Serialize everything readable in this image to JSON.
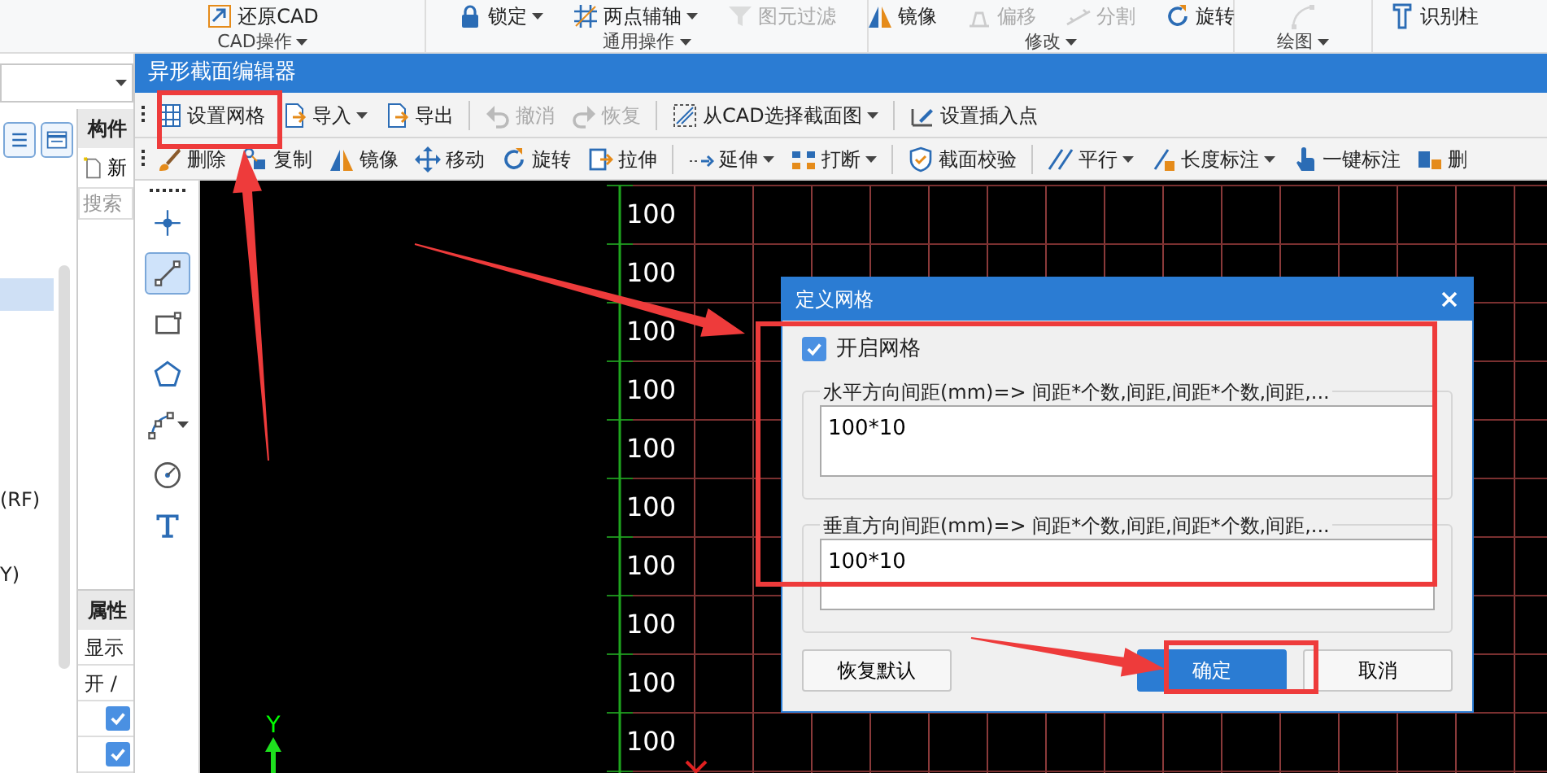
{
  "ribbon": {
    "groups": [
      {
        "label": "CAD操作",
        "items": [
          {
            "label": "还原CAD",
            "disabled": false,
            "dropdown": false
          }
        ]
      },
      {
        "label": "通用操作",
        "items": [
          {
            "label": "锁定",
            "disabled": false,
            "dropdown": true
          },
          {
            "label": "两点辅轴",
            "disabled": false,
            "dropdown": true
          },
          {
            "label": "图元过滤",
            "disabled": true,
            "dropdown": false
          }
        ]
      },
      {
        "label": "修改",
        "items": [
          {
            "label": "镜像",
            "disabled": false,
            "dropdown": false
          },
          {
            "label": "偏移",
            "disabled": true,
            "dropdown": false
          },
          {
            "label": "分割",
            "disabled": true,
            "dropdown": false
          },
          {
            "label": "旋转",
            "disabled": false,
            "dropdown": false
          }
        ]
      },
      {
        "label": "绘图",
        "items": [
          {
            "disabled": true,
            "dropdown": false
          }
        ]
      },
      {
        "items": [
          {
            "label": "识别柱",
            "disabled": false,
            "dropdown": false
          }
        ]
      }
    ]
  },
  "tree_panel": {
    "rows": [
      {
        "selected": true
      },
      {
        "text": "(RF)",
        "selected": false
      },
      {
        "text": "Y)",
        "selected": false
      }
    ]
  },
  "component_panel": {
    "title": "构件",
    "new_label": "新",
    "search_placeholder": "搜索"
  },
  "property_panel": {
    "title": "属性",
    "column_label": "显示",
    "header_cell": "开 /",
    "rows": [
      {
        "checked": true
      },
      {
        "checked": true
      }
    ]
  },
  "editor": {
    "title": "异形截面编辑器",
    "toolbar_1": [
      {
        "kind": "button",
        "label": "设置网格",
        "disabled": false,
        "dropdown": false
      },
      {
        "kind": "button",
        "label": "导入",
        "disabled": false,
        "dropdown": true
      },
      {
        "kind": "button",
        "label": "导出",
        "disabled": false,
        "dropdown": false
      },
      {
        "kind": "separator"
      },
      {
        "kind": "button",
        "label": "撤消",
        "disabled": true,
        "dropdown": false
      },
      {
        "kind": "button",
        "label": "恢复",
        "disabled": true,
        "dropdown": false
      },
      {
        "kind": "separator"
      },
      {
        "kind": "button",
        "label": "从CAD选择截面图",
        "disabled": false,
        "dropdown": true
      },
      {
        "kind": "separator"
      },
      {
        "kind": "button",
        "label": "设置插入点",
        "disabled": false,
        "dropdown": false
      }
    ],
    "toolbar_2": [
      {
        "kind": "button",
        "label": "删除",
        "disabled": false,
        "dropdown": false
      },
      {
        "kind": "button",
        "label": "复制",
        "disabled": false,
        "dropdown": false
      },
      {
        "kind": "button",
        "label": "镜像",
        "disabled": false,
        "dropdown": false
      },
      {
        "kind": "button",
        "label": "移动",
        "disabled": false,
        "dropdown": false
      },
      {
        "kind": "button",
        "label": "旋转",
        "disabled": false,
        "dropdown": false
      },
      {
        "kind": "button",
        "label": "拉伸",
        "disabled": false,
        "dropdown": false
      },
      {
        "kind": "separator"
      },
      {
        "kind": "button",
        "label": "延伸",
        "disabled": false,
        "dropdown": true
      },
      {
        "kind": "button",
        "label": "打断",
        "disabled": false,
        "dropdown": true
      },
      {
        "kind": "separator"
      },
      {
        "kind": "button",
        "label": "截面校验",
        "disabled": false,
        "dropdown": false
      },
      {
        "kind": "separator"
      },
      {
        "kind": "button",
        "label": "平行",
        "disabled": false,
        "dropdown": true
      },
      {
        "kind": "button",
        "label": "长度标注",
        "disabled": false,
        "dropdown": true
      },
      {
        "kind": "button",
        "label": "一键标注",
        "disabled": false,
        "dropdown": false
      },
      {
        "kind": "button",
        "label": "删",
        "disabled": false,
        "dropdown": false
      }
    ],
    "tools": [
      {
        "selected": false,
        "dropdown": false
      },
      {
        "selected": true,
        "dropdown": false
      },
      {
        "selected": false,
        "dropdown": false
      },
      {
        "selected": false,
        "dropdown": false
      },
      {
        "selected": false,
        "dropdown": true
      },
      {
        "selected": false,
        "dropdown": false
      },
      {
        "selected": false,
        "dropdown": false
      }
    ],
    "canvas": {
      "row_labels": [
        "100",
        "100",
        "100",
        "100",
        "100",
        "100",
        "100",
        "100",
        "100",
        "100"
      ],
      "y_axis_label": "Y"
    }
  },
  "dialog": {
    "title": "定义网格",
    "enable_grid": {
      "label": "开启网格",
      "checked": true
    },
    "groups": [
      {
        "legend": "水平方向间距(mm)=> 间距*个数,间距,间距*个数,间距,...",
        "value": "100*10"
      },
      {
        "legend": "垂直方向间距(mm)=> 间距*个数,间距,间距*个数,间距,...",
        "value": "100*10"
      }
    ],
    "buttons": [
      {
        "label": "恢复默认",
        "primary": false
      },
      {
        "label": "确定",
        "primary": true
      },
      {
        "label": "取消",
        "primary": false
      }
    ]
  }
}
